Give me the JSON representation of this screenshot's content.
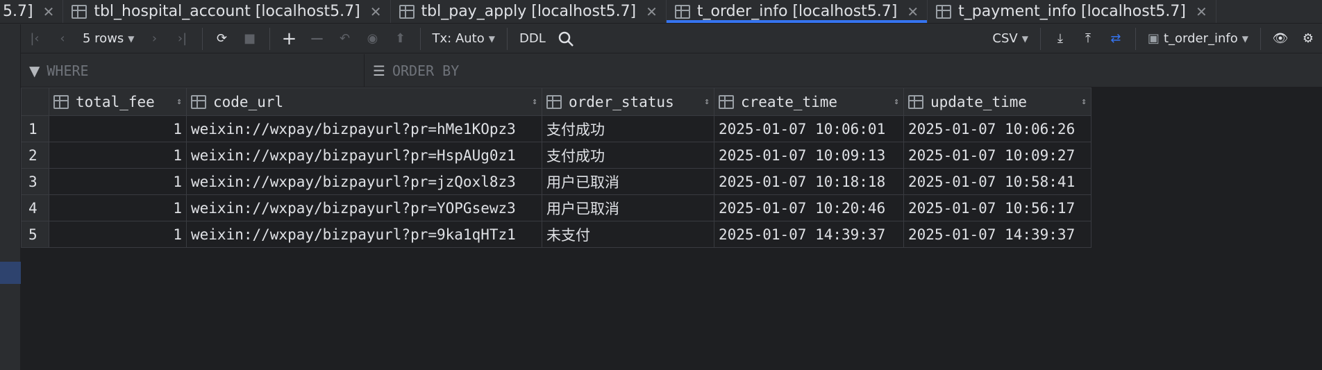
{
  "tabs": [
    {
      "label": "5.7]",
      "active": false
    },
    {
      "label": "tbl_hospital_account [localhost5.7]",
      "active": false
    },
    {
      "label": "tbl_pay_apply [localhost5.7]",
      "active": false
    },
    {
      "label": "t_order_info [localhost5.7]",
      "active": true
    },
    {
      "label": "t_payment_info [localhost5.7]",
      "active": false
    }
  ],
  "toolbar": {
    "rows_label": "5 rows",
    "tx_label": "Tx: Auto",
    "ddl_label": "DDL",
    "export_format": "CSV",
    "table_selector": "t_order_info"
  },
  "filter": {
    "where_placeholder": "WHERE",
    "orderby_placeholder": "ORDER BY"
  },
  "grid": {
    "columns": [
      "total_fee",
      "code_url",
      "order_status",
      "create_time",
      "update_time"
    ],
    "rows": [
      {
        "num": "1",
        "total_fee": "1",
        "code_url": "weixin://wxpay/bizpayurl?pr=hMe1KOpz3",
        "order_status": "支付成功",
        "create_time": "2025-01-07 10:06:01",
        "update_time": "2025-01-07 10:06:26"
      },
      {
        "num": "2",
        "total_fee": "1",
        "code_url": "weixin://wxpay/bizpayurl?pr=HspAUg0z1",
        "order_status": "支付成功",
        "create_time": "2025-01-07 10:09:13",
        "update_time": "2025-01-07 10:09:27"
      },
      {
        "num": "3",
        "total_fee": "1",
        "code_url": "weixin://wxpay/bizpayurl?pr=jzQoxl8z3",
        "order_status": "用户已取消",
        "create_time": "2025-01-07 10:18:18",
        "update_time": "2025-01-07 10:58:41"
      },
      {
        "num": "4",
        "total_fee": "1",
        "code_url": "weixin://wxpay/bizpayurl?pr=YOPGsewz3",
        "order_status": "用户已取消",
        "create_time": "2025-01-07 10:20:46",
        "update_time": "2025-01-07 10:56:17"
      },
      {
        "num": "5",
        "total_fee": "1",
        "code_url": "weixin://wxpay/bizpayurl?pr=9ka1qHTz1",
        "order_status": "未支付",
        "create_time": "2025-01-07 14:39:37",
        "update_time": "2025-01-07 14:39:37"
      }
    ]
  },
  "colors": {
    "background": "#1e1f22",
    "panel": "#2b2d30",
    "accent": "#3574f0",
    "text": "#dfe1e5"
  }
}
